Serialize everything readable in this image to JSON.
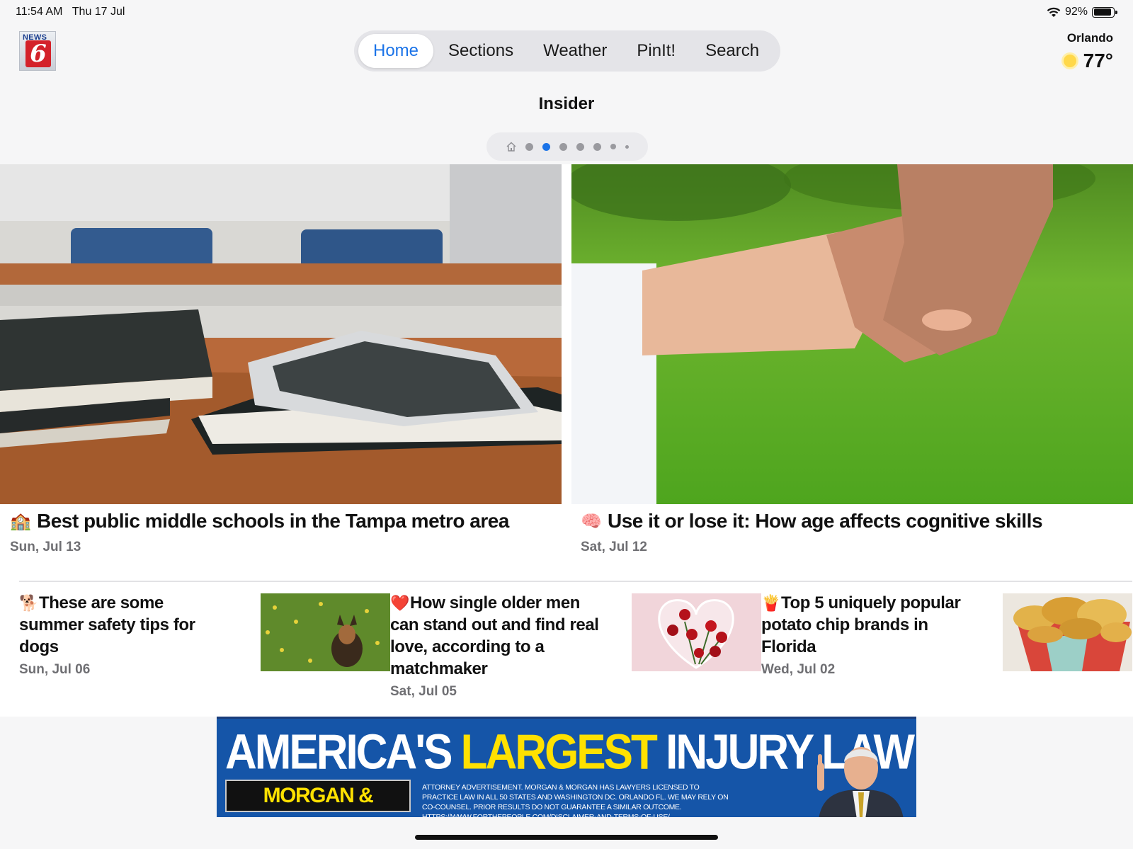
{
  "status_bar": {
    "time": "11:54 AM",
    "date": "Thu 17 Jul",
    "battery": "92%",
    "battery_level": 0.92
  },
  "logo": {
    "news": "NEWS",
    "number": "6"
  },
  "nav": {
    "tabs": [
      {
        "label": "Home",
        "active": true
      },
      {
        "label": "Sections",
        "active": false
      },
      {
        "label": "Weather",
        "active": false
      },
      {
        "label": "PinIt!",
        "active": false
      },
      {
        "label": "Search",
        "active": false
      }
    ]
  },
  "weather": {
    "city": "Orlando",
    "temp": "77°",
    "icon": "sun-icon"
  },
  "page": {
    "title": "Insider",
    "pager_pages": 7,
    "pager_active": 2
  },
  "hero_stories": [
    {
      "emoji": "🏫",
      "title": "Best public middle schools in the Tampa metro area",
      "date": "Sun, Jul 13"
    },
    {
      "emoji": "🧠",
      "title": "Use it or lose it: How age affects cognitive skills",
      "date": "Sat, Jul 12"
    }
  ],
  "stories": [
    {
      "emoji": "🐕",
      "title": "These are some summer safety tips for dogs",
      "date": "Sun, Jul 06"
    },
    {
      "emoji": "❤️",
      "title": "How single older men can stand out and find real love, according to a matchmaker",
      "date": "Sat, Jul 05"
    },
    {
      "emoji": "🍟",
      "title": "Top 5 uniquely popular potato chip brands in Florida",
      "date": "Wed, Jul 02"
    }
  ],
  "ad": {
    "headline_1": "AMERICA'S ",
    "headline_2": "LARGEST",
    "headline_3": " INJURY LAW FIRM",
    "firm": "MORGAN & MORGAN",
    "fine_print": "ATTORNEY ADVERTISEMENT. MORGAN & MORGAN HAS LAWYERS LICENSED TO PRACTICE LAW IN ALL 50 STATES AND WASHINGTON DC. ORLANDO FL. WE MAY RELY ON CO-COUNSEL. PRIOR RESULTS DO NOT GUARANTEE A SIMILAR OUTCOME. HTTPS://WWW.FORTHEPEOPLE.COM/DISCLAIMER-AND-TERMS-OF-USE/"
  },
  "colors": {
    "accent": "#1a73e8",
    "ad_blue": "#1555a8",
    "ad_yellow": "#ffe100"
  }
}
